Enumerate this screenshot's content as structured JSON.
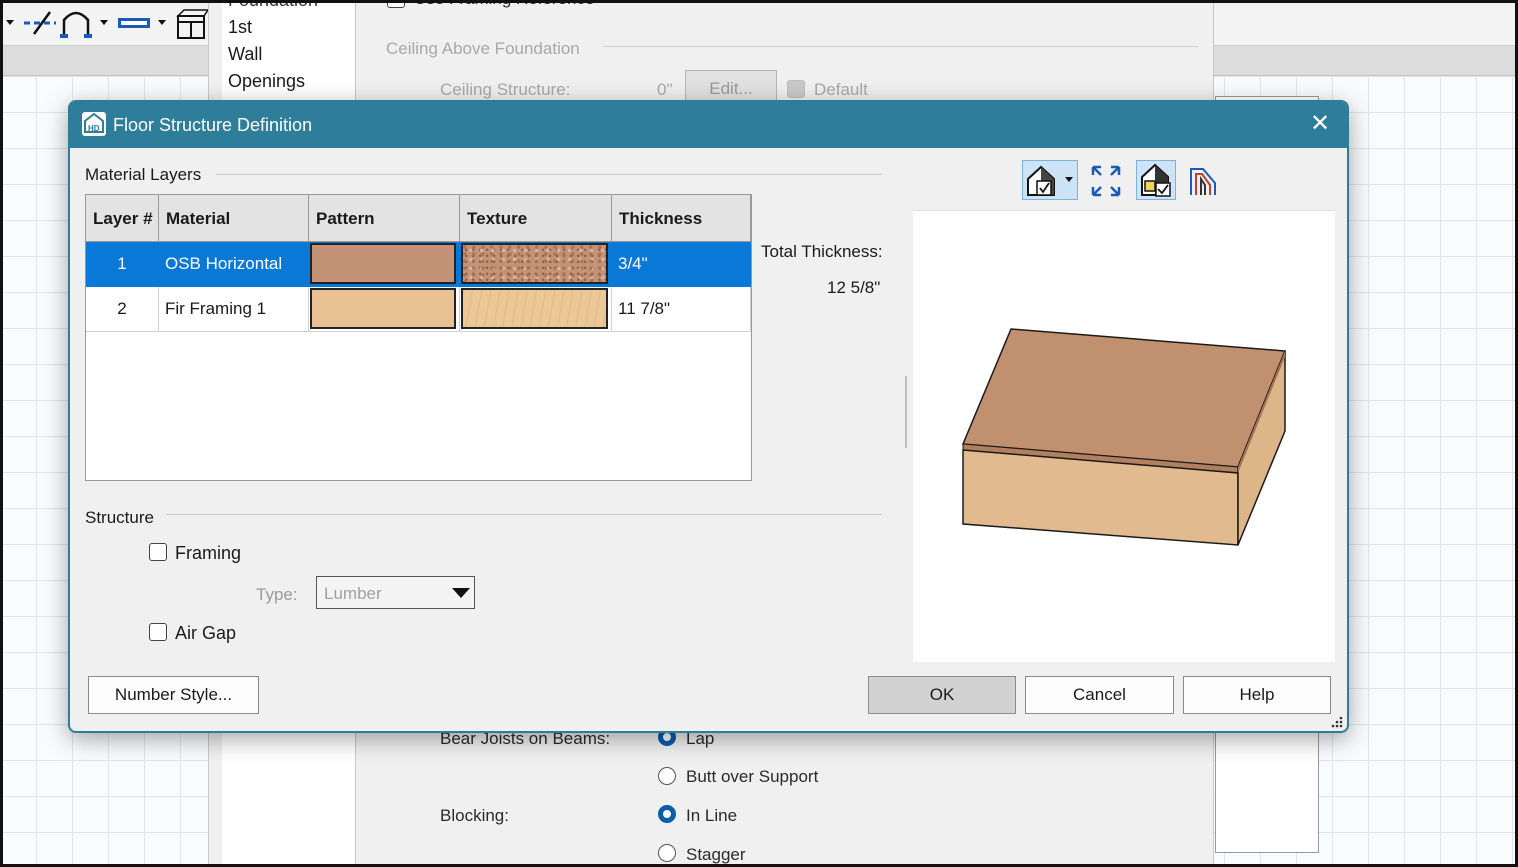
{
  "background": {
    "tree_items": [
      "Foundation",
      "1st",
      "Wall",
      "Openings"
    ],
    "use_framing_reference": "Use Framing Reference",
    "ceiling_above_foundation": "Ceiling Above Foundation",
    "ceiling_structure_label": "Ceiling Structure:",
    "ceiling_structure_value": "0\"",
    "edit_button": "Edit...",
    "default_label": "Default",
    "bear_joists_label": "Bear Joists on Beams:",
    "bear_options": [
      "Lap",
      "Butt over Support"
    ],
    "blocking_label": "Blocking:",
    "blocking_options": [
      "In Line",
      "Stagger"
    ]
  },
  "dialog": {
    "title": "Floor Structure Definition",
    "material_layers_label": "Material Layers",
    "columns": [
      "Layer #",
      "Material",
      "Pattern",
      "Texture",
      "Thickness"
    ],
    "rows": [
      {
        "layer": "1",
        "material": "OSB Horizontal",
        "pattern_color": "#c49277",
        "texture": "osb",
        "thickness": "3/4\""
      },
      {
        "layer": "2",
        "material": "Fir Framing 1",
        "pattern_color": "#e8c294",
        "texture": "fir",
        "thickness": "11 7/8\""
      }
    ],
    "total_thickness_label": "Total Thickness:",
    "total_thickness_value": "12 5/8\"",
    "structure_label": "Structure",
    "framing_label": "Framing",
    "type_label": "Type:",
    "type_value": "Lumber",
    "air_gap_label": "Air Gap",
    "buttons": {
      "number_style": "Number Style...",
      "ok": "OK",
      "cancel": "Cancel",
      "help": "Help"
    },
    "preview_tools": [
      "view-options-icon",
      "fill-window-icon",
      "color-toggle-icon",
      "layer-lines-icon"
    ]
  },
  "colors": {
    "titlebar": "#2e7d9a",
    "selection": "#0a78d7",
    "osb": "#c49277",
    "fir": "#e0bc8e"
  }
}
